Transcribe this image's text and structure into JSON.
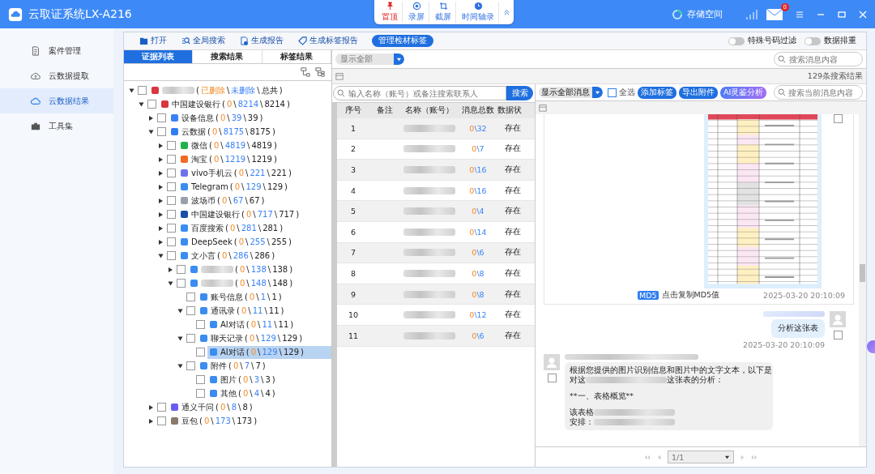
{
  "window": {
    "title": "云取证系统LX-A216"
  },
  "float_toolbar": [
    {
      "label": "置顶"
    },
    {
      "label": "录屏"
    },
    {
      "label": "截屏"
    },
    {
      "label": "时间轴录"
    }
  ],
  "status": {
    "storage": "存储空间",
    "mail_badge": "0"
  },
  "nav": [
    {
      "label": "案件管理",
      "selected": false
    },
    {
      "label": "云数据提取",
      "selected": false
    },
    {
      "label": "云数据结果",
      "selected": true
    },
    {
      "label": "工具集",
      "selected": false
    }
  ],
  "toolbar": [
    {
      "label": "打开",
      "kind": "plain"
    },
    {
      "label": "全局搜索",
      "kind": "plain"
    },
    {
      "label": "生成报告",
      "kind": "plain"
    },
    {
      "label": "生成标签报告",
      "kind": "plain"
    },
    {
      "label": "管理检材标签",
      "kind": "pill"
    }
  ],
  "toggles": [
    {
      "label": "特殊号码过滤",
      "on": false
    },
    {
      "label": "数据排重",
      "on": false
    }
  ],
  "tabs": [
    {
      "label": "证据列表",
      "selected": true
    },
    {
      "label": "搜索结果",
      "selected": false
    },
    {
      "label": "标签结果",
      "selected": false
    }
  ],
  "tree": [
    {
      "kind": "bank",
      "blur": true,
      "counts": [
        "(",
        "已删除",
        "\\",
        "未删除",
        "\\",
        "总共",
        ")"
      ],
      "expanded": true,
      "checked": false,
      "selected": false,
      "children": [
        {
          "label": "中国建设银行",
          "kind": "bank",
          "counts": [
            "(",
            "0",
            "\\",
            "8214",
            "\\",
            "8214",
            ")"
          ],
          "expanded": true,
          "checked": false,
          "selected": false,
          "children": [
            {
              "label": "设备信息",
              "kind": "phone",
              "counts": [
                "(",
                "0",
                "\\",
                "39",
                "\\",
                "39",
                ")"
              ],
              "expanded": false,
              "checked": false,
              "selected": false
            },
            {
              "label": "云数据",
              "kind": "cloud",
              "counts": [
                "(",
                "0",
                "\\",
                "8175",
                "\\",
                "8175",
                ")"
              ],
              "expanded": true,
              "checked": false,
              "selected": false,
              "children": [
                {
                  "label": "微信",
                  "kind": "wechat",
                  "counts": [
                    "(",
                    "0",
                    "\\",
                    "4819",
                    "\\",
                    "4819",
                    ")"
                  ],
                  "expanded": false,
                  "checked": false,
                  "selected": false
                },
                {
                  "label": "淘宝",
                  "kind": "taobao",
                  "counts": [
                    "(",
                    "0",
                    "\\",
                    "1219",
                    "\\",
                    "1219",
                    ")"
                  ],
                  "expanded": false,
                  "checked": false,
                  "selected": false
                },
                {
                  "label": "vivo手机云",
                  "kind": "vivo",
                  "counts": [
                    "(",
                    "0",
                    "\\",
                    "221",
                    "\\",
                    "221",
                    ")"
                  ],
                  "expanded": false,
                  "checked": false,
                  "selected": false
                },
                {
                  "label": "Telegram",
                  "kind": "app",
                  "counts": [
                    "(",
                    "0",
                    "\\",
                    "129",
                    "\\",
                    "129",
                    ")"
                  ],
                  "expanded": false,
                  "checked": false,
                  "selected": false
                },
                {
                  "label": "波场币",
                  "kind": "coin",
                  "counts": [
                    "(",
                    "0",
                    "\\",
                    "67",
                    "\\",
                    "67",
                    ")"
                  ],
                  "expanded": false,
                  "checked": false,
                  "selected": false
                },
                {
                  "label": "中国建设银行",
                  "kind": "ring",
                  "counts": [
                    "(",
                    "0",
                    "\\",
                    "717",
                    "\\",
                    "717",
                    ")"
                  ],
                  "expanded": false,
                  "checked": false,
                  "selected": false
                },
                {
                  "label": "百度搜索",
                  "kind": "app",
                  "counts": [
                    "(",
                    "0",
                    "\\",
                    "281",
                    "\\",
                    "281",
                    ")"
                  ],
                  "expanded": false,
                  "checked": false,
                  "selected": false
                },
                {
                  "label": "DeepSeek",
                  "kind": "app",
                  "counts": [
                    "(",
                    "0",
                    "\\",
                    "255",
                    "\\",
                    "255",
                    ")"
                  ],
                  "expanded": false,
                  "checked": false,
                  "selected": false
                },
                {
                  "label": "文小言",
                  "kind": "app",
                  "counts": [
                    "(",
                    "0",
                    "\\",
                    "286",
                    "\\",
                    "286",
                    ")"
                  ],
                  "expanded": true,
                  "checked": false,
                  "selected": false,
                  "children": [
                    {
                      "kind": "app",
                      "blur": true,
                      "counts": [
                        "(",
                        "0",
                        "\\",
                        "138",
                        "\\",
                        "138",
                        ")"
                      ],
                      "expanded": false,
                      "checked": false,
                      "selected": false
                    },
                    {
                      "kind": "app",
                      "blur": true,
                      "counts": [
                        "(",
                        "0",
                        "\\",
                        "148",
                        "\\",
                        "148",
                        ")"
                      ],
                      "expanded": true,
                      "checked": false,
                      "selected": false,
                      "children": [
                        {
                          "label": "账号信息",
                          "kind": "app",
                          "counts": [
                            "(",
                            "0",
                            "\\",
                            "1",
                            "\\",
                            "1",
                            ")"
                          ],
                          "checked": false,
                          "selected": false
                        },
                        {
                          "label": "通讯录",
                          "kind": "app",
                          "counts": [
                            "(",
                            "0",
                            "\\",
                            "11",
                            "\\",
                            "11",
                            ")"
                          ],
                          "expanded": true,
                          "checked": false,
                          "selected": false,
                          "children": [
                            {
                              "label": "AI对话",
                              "kind": "app",
                              "counts": [
                                "(",
                                "0",
                                "\\",
                                "11",
                                "\\",
                                "11",
                                ")"
                              ],
                              "checked": false,
                              "selected": false
                            }
                          ]
                        },
                        {
                          "label": "聊天记录",
                          "kind": "app",
                          "counts": [
                            "(",
                            "0",
                            "\\",
                            "129",
                            "\\",
                            "129",
                            ")"
                          ],
                          "expanded": true,
                          "checked": false,
                          "selected": false,
                          "children": [
                            {
                              "label": "AI对话",
                              "kind": "app",
                              "counts": [
                                "(",
                                "0",
                                "\\",
                                "129",
                                "\\",
                                "129",
                                ")"
                              ],
                              "checked": false,
                              "selected": true
                            }
                          ]
                        },
                        {
                          "label": "附件",
                          "kind": "app",
                          "counts": [
                            "(",
                            "0",
                            "\\",
                            "7",
                            "\\",
                            "7",
                            ")"
                          ],
                          "expanded": true,
                          "checked": false,
                          "selected": false,
                          "children": [
                            {
                              "label": "图片",
                              "kind": "app",
                              "counts": [
                                "(",
                                "0",
                                "\\",
                                "3",
                                "\\",
                                "3",
                                ")"
                              ],
                              "checked": false,
                              "selected": false
                            },
                            {
                              "label": "其他",
                              "kind": "app",
                              "counts": [
                                "(",
                                "0",
                                "\\",
                                "4",
                                "\\",
                                "4",
                                ")"
                              ],
                              "checked": false,
                              "selected": false
                            }
                          ]
                        }
                      ]
                    }
                  ]
                }
              ]
            },
            {
              "label": "通义千问",
              "kind": "tongyi",
              "counts": [
                "(",
                "0",
                "\\",
                "8",
                "\\",
                "8",
                ")"
              ],
              "expanded": false,
              "checked": false,
              "selected": false
            },
            {
              "label": "豆包",
              "kind": "doubao",
              "counts": [
                "(",
                "0",
                "\\",
                "173",
                "\\",
                "173",
                ")"
              ],
              "expanded": false,
              "checked": false,
              "selected": false
            }
          ]
        }
      ]
    }
  ],
  "filter": {
    "value": "显示全部",
    "search_placeholder": "搜索消息内容",
    "result_count": "129条搜索结果"
  },
  "contacts": {
    "placeholder": "输入名称（账号）或备注搜索联系人",
    "search_button": "搜索",
    "columns": [
      "序号",
      "备注",
      "名称（账号）",
      "消息总数",
      "数据状"
    ],
    "rows": [
      {
        "index": "1",
        "messages": [
          "0",
          "\\32"
        ],
        "status": "存在"
      },
      {
        "index": "2",
        "messages": [
          "0",
          "\\7"
        ],
        "status": "存在"
      },
      {
        "index": "3",
        "messages": [
          "0",
          "\\16"
        ],
        "status": "存在"
      },
      {
        "index": "4",
        "messages": [
          "0",
          "\\16"
        ],
        "status": "存在"
      },
      {
        "index": "5",
        "messages": [
          "0",
          "\\4"
        ],
        "status": "存在"
      },
      {
        "index": "6",
        "messages": [
          "0",
          "\\14"
        ],
        "status": "存在"
      },
      {
        "index": "7",
        "messages": [
          "0",
          "\\6"
        ],
        "status": "存在"
      },
      {
        "index": "8",
        "messages": [
          "0",
          "\\8"
        ],
        "status": "存在"
      },
      {
        "index": "9",
        "messages": [
          "0",
          "\\8"
        ],
        "status": "存在"
      },
      {
        "index": "10",
        "messages": [
          "0",
          "\\12"
        ],
        "status": "存在"
      },
      {
        "index": "11",
        "messages": [
          "0",
          "\\6"
        ],
        "status": "存在"
      }
    ]
  },
  "message_toolbar": {
    "show": "显示全部消息",
    "select_all": {
      "label": "全选",
      "checked": false
    },
    "buttons": [
      {
        "label": "添加标签",
        "kind": "blue"
      },
      {
        "label": "导出附件",
        "kind": "blue"
      },
      {
        "label": "AI灵鉴分析",
        "kind": "ai"
      }
    ],
    "search_placeholder": "搜索当前消息内容"
  },
  "messages": [
    {
      "md5_badge": "MD5",
      "md5_text": "点击复制MD5值",
      "time": "2025-03-20 20:10:09",
      "checked": false
    },
    {
      "kind": "outgoing",
      "text": "分析这张表",
      "time": "2025-03-20 20:10:09",
      "checked": false
    },
    {
      "kind": "incoming",
      "checked": false,
      "paragraphs": [
        [
          {
            "text": "根据您提供的图片识别信息和图片中的文字文本，以下是"
          },
          {
            "text": "对这",
            "blur": true,
            "tail": "这张表的分析："
          }
        ],
        [
          {
            "text": "**一、表格概览**"
          }
        ],
        [
          {
            "text": "该表格",
            "blur": true
          },
          {
            "text": "安排：",
            "blur": true
          }
        ]
      ]
    }
  ],
  "pager": {
    "page": "1/1"
  }
}
